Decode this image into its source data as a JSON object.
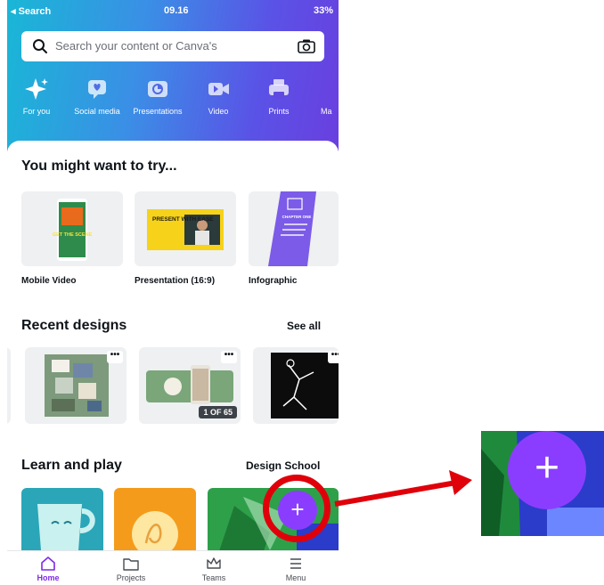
{
  "status_bar": {
    "carrier": "◂ Search",
    "time": "09.16",
    "battery": "33%"
  },
  "search": {
    "placeholder": "Search your content or Canva's"
  },
  "categories": [
    {
      "label": "For you",
      "icon": "sparkle-icon"
    },
    {
      "label": "Social media",
      "icon": "heart-chat-icon"
    },
    {
      "label": "Presentations",
      "icon": "presentation-icon"
    },
    {
      "label": "Video",
      "icon": "video-icon"
    },
    {
      "label": "Prints",
      "icon": "printer-icon"
    },
    {
      "label": "Ma",
      "icon": "marketing-icon"
    }
  ],
  "try_section": {
    "title": "You might want to try...",
    "items": [
      {
        "label": "Mobile Video",
        "thumb_text": "GET THE SCENE"
      },
      {
        "label": "Presentation (16:9)",
        "thumb_text": "PRESENT WITH EASE"
      },
      {
        "label": "Infographic",
        "thumb_text": "CHAPTER ONE"
      }
    ]
  },
  "recent_section": {
    "title": "Recent designs",
    "see_all": "See all",
    "more_label": "•••",
    "pager": "1 OF 65"
  },
  "learn_section": {
    "title": "Learn and play",
    "link": "Design School"
  },
  "fab": {
    "label": "+"
  },
  "tabs": [
    {
      "label": "Home",
      "icon": "home-icon",
      "active": true
    },
    {
      "label": "Projects",
      "icon": "folder-icon",
      "active": false
    },
    {
      "label": "Teams",
      "icon": "crown-icon",
      "active": false
    },
    {
      "label": "Menu",
      "icon": "menu-icon",
      "active": false
    }
  ],
  "colors": {
    "accent": "#8b3dff",
    "highlight": "#e0000a",
    "active_tab": "#7d2ae8"
  }
}
